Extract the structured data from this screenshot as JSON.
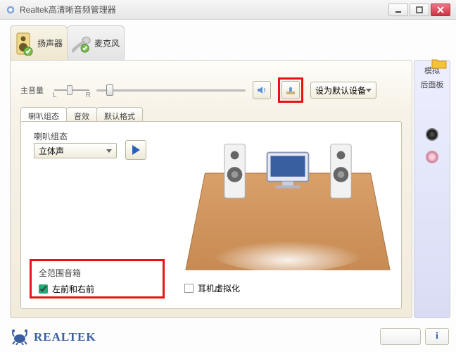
{
  "window": {
    "title": "Realtek高清晰音频管理器"
  },
  "tabs": {
    "speaker": "扬声器",
    "mic": "麦克风"
  },
  "volume": {
    "label": "主音量",
    "balance_l": "L",
    "balance_r": "R",
    "default_device": "设为默认设备"
  },
  "sub_tabs": {
    "config": "喇叭组态",
    "effect": "音效",
    "format": "默认格式"
  },
  "config": {
    "label": "喇叭组态",
    "selected": "立体声"
  },
  "full_range": {
    "title": "全范围音箱",
    "opt": "左前和右前"
  },
  "hp_virt": "耳机虚拟化",
  "side": {
    "title": "模拟",
    "sub": "后面板"
  },
  "footer": {
    "brand": "REALTEK",
    "info": "i"
  }
}
